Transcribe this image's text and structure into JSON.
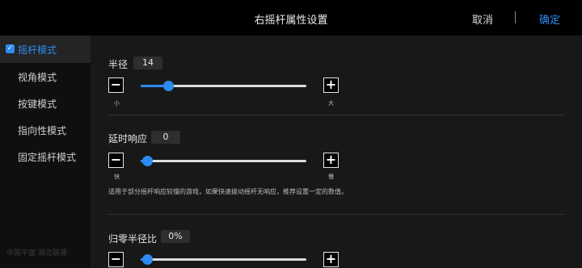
{
  "header": {
    "title": "右摇杆属性设置",
    "cancel_label": "取消",
    "confirm_label": "确定"
  },
  "sidebar": {
    "items": [
      {
        "label": "摇杆模式",
        "active": true
      },
      {
        "label": "视角模式",
        "active": false
      },
      {
        "label": "按键模式",
        "active": false
      },
      {
        "label": "指向性模式",
        "active": false
      },
      {
        "label": "固定摇杆模式",
        "active": false
      }
    ],
    "faded_text": "中国平面 湖北联通"
  },
  "settings": {
    "radius": {
      "label": "半径",
      "value": "14",
      "level": 0.14,
      "min_label": "小",
      "max_label": "大"
    },
    "delay": {
      "label": "延时响应",
      "value": "0",
      "level": 0,
      "min_label": "快",
      "max_label": "慢",
      "note": "适用于部分摇杆响应较慢的游戏，如果快速拨动摇杆无响应，推荐设置一定的数值。"
    },
    "reset_radius": {
      "label": "归零半径比",
      "value": "0%",
      "level": 0
    }
  },
  "icons": {
    "minus": "minus-icon",
    "plus": "plus-icon",
    "check": "checkbox-checked-icon"
  },
  "colors": {
    "accent": "#2d8cf0",
    "header_bg": "#000000",
    "sidebar_bg": "#0f0f0f",
    "content_bg": "#181818"
  }
}
